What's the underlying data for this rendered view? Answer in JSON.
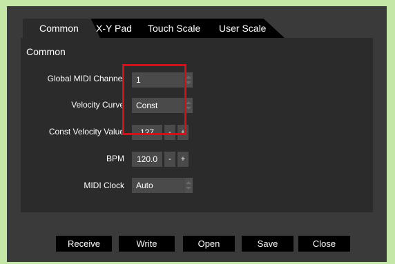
{
  "tabs": [
    {
      "label": "Common"
    },
    {
      "label": "X-Y Pad"
    },
    {
      "label": "Touch Scale"
    },
    {
      "label": "User Scale"
    }
  ],
  "section_title": "Common",
  "settings": {
    "global_midi_channel": {
      "label": "Global MIDI Channel",
      "value": "1"
    },
    "velocity_curve": {
      "label": "Velocity Curve",
      "value": "Const"
    },
    "const_velocity_value": {
      "label": "Const Velocity Value",
      "value": "127",
      "minus": "-",
      "plus": "+"
    },
    "bpm": {
      "label": "BPM",
      "value": "120.0",
      "minus": "-",
      "plus": "+"
    },
    "midi_clock": {
      "label": "MIDI Clock",
      "value": "Auto"
    }
  },
  "buttons": {
    "receive": "Receive",
    "write": "Write",
    "open": "Open",
    "save": "Save",
    "close": "Close"
  },
  "colors": {
    "background": "#c4e7a8",
    "window": "#3a3a3a",
    "panel": "#2b2b2b",
    "highlight": "#d0131b"
  }
}
